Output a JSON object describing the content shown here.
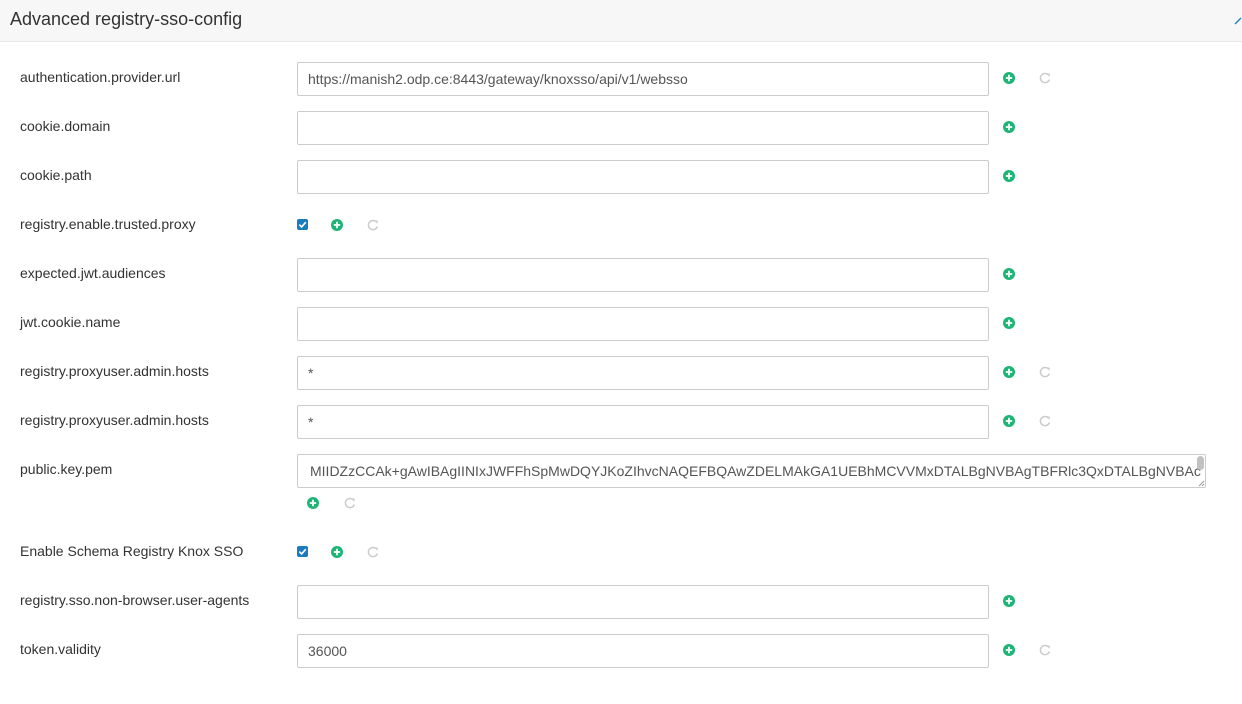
{
  "header": {
    "title": "Advanced registry-sso-config"
  },
  "colors": {
    "accent_green": "#1eb475",
    "checkbox_blue": "#1a7bbd",
    "undo_gray": "#cccccc"
  },
  "fields": [
    {
      "name": "authentication.provider.url",
      "value": "https://manish2.odp.ce:8443/gateway/knoxsso/api/v1/websso"
    },
    {
      "name": "cookie.domain",
      "value": ""
    },
    {
      "name": "cookie.path",
      "value": ""
    },
    {
      "name": "registry.enable.trusted.proxy",
      "checked": true
    },
    {
      "name": "expected.jwt.audiences",
      "value": ""
    },
    {
      "name": "jwt.cookie.name",
      "value": ""
    },
    {
      "name": "registry.proxyuser.admin.hosts",
      "value": "*"
    },
    {
      "name": "registry.proxyuser.admin.hosts",
      "value": "*"
    },
    {
      "name": "public.key.pem",
      "value": "MIIDZzCCAk+gAwIBAgIINIxJWFFhSpMwDQYJKoZIhvcNAQEFBQAwZDELMAkGA1UEBhMCVVMxDTALBgNVBAgTBFRlc3QxDTALBgNVBAc"
    },
    {
      "name": "Enable Schema Registry Knox SSO",
      "checked": true
    },
    {
      "name": "registry.sso.non-browser.user-agents",
      "value": ""
    },
    {
      "name": "token.validity",
      "value": "36000"
    }
  ],
  "icons": {
    "add": "plus-circle-icon",
    "undo": "undo-icon",
    "collapse": "collapse-icon"
  }
}
